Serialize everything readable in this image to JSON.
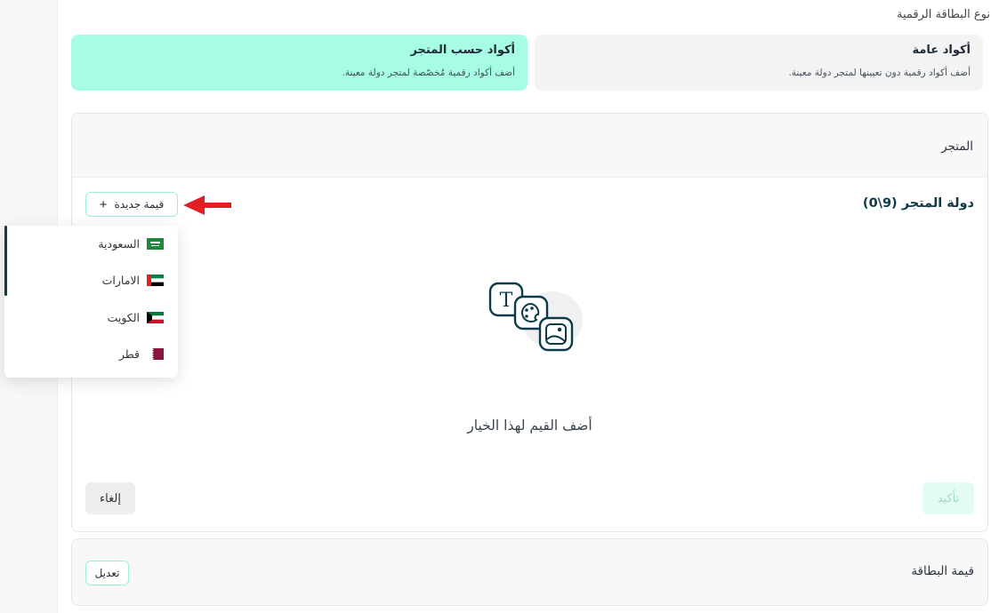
{
  "card_type": {
    "label": "نوع البطاقة الرقمية",
    "options": [
      {
        "title": "أكواد عامة",
        "subtitle": "أضف أكواد رقمية دون تعيينها لمتجر دولة معينة."
      },
      {
        "title": "أكواد حسب المتجر",
        "subtitle": "أضف أكواد رقمية مُخصّصة لمتجر دولة معينة."
      }
    ]
  },
  "store_panel": {
    "header": "المتجر",
    "country_title": "دولة المتجر (9\\0)",
    "new_value_label": "قيمة جديدة",
    "empty_text": "أضف القيم لهذا الخيار",
    "confirm_label": "تأكيد",
    "cancel_label": "إلغاء"
  },
  "card_value": {
    "title": "قيمة البطاقة",
    "edit_label": "تعديل"
  },
  "dropdown": {
    "items": [
      {
        "label": "السعودية",
        "flag": "saudi-flag-icon"
      },
      {
        "label": "الامارات",
        "flag": "uae-flag-icon"
      },
      {
        "label": "الكويت",
        "flag": "kuwait-flag-icon"
      },
      {
        "label": "قطر",
        "flag": "qatar-flag-icon"
      }
    ]
  },
  "colors": {
    "accent": "#a6fde3",
    "accent_border": "#9bf0d6",
    "dark_teal": "#0c3b4a",
    "annotation_arrow": "#e31e24"
  }
}
